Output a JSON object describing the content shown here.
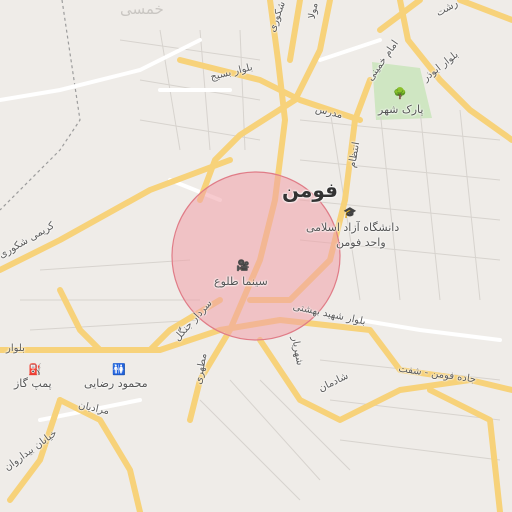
{
  "map": {
    "city": "فومن",
    "faded_top_label": "خمسی",
    "highlight_circle": {
      "fill": "#f0a0a8",
      "stroke": "#e07c87"
    },
    "colors": {
      "background": "#efece8",
      "park": "#cfe6c2",
      "major_road": "#f7d27a",
      "minor_road": "#ffffff",
      "block_line": "#d7d3ce",
      "boundary": "#9c9c9c"
    }
  },
  "pois": [
    {
      "name": "university",
      "icon": "university-icon",
      "label_line1": "دانشگاه آزاد اسلامی",
      "label_line2": "واحد فومن"
    },
    {
      "name": "cinema",
      "icon": "cinema-icon",
      "label": "سینما طلوع"
    },
    {
      "name": "park",
      "icon": "tree-icon",
      "label": "پارک شهر"
    },
    {
      "name": "gas-station",
      "icon": "fuel-pump-icon",
      "label": "پمپ گاز"
    },
    {
      "name": "restroom",
      "icon": "restroom-icon",
      "label": "محمود رضایی"
    }
  ],
  "roads": {
    "basij": "بلوار بسیج",
    "modares": "مدرس",
    "entezam": "انتظام",
    "imam_khomeini": "امام خمینی",
    "abouzar": "بلوار ابوذر",
    "karimi_shakouri": "کریمی شکوری",
    "sardar_jangal": "سردار جنگل",
    "shahid_beheshti": "بلوار شهید بهشتی",
    "shadman": "شادمان",
    "fouman_shaft": "جاده فومن - شفت",
    "mardian": "مرادیان",
    "bidaravan": "خیابان بیداروان",
    "bolvar": "بلوار",
    "motahari": "مطهری",
    "shahriar": "شهریار",
    "shakouri_top": "شکوری",
    "rasht": "رشت",
    "mola": "مولا"
  }
}
